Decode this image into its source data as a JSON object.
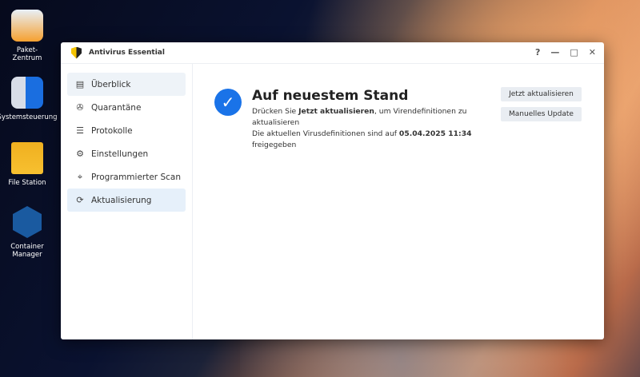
{
  "desktop": [
    {
      "label": "Paket-\nZentrum"
    },
    {
      "label": "Systemsteuerung"
    },
    {
      "label": "File Station"
    },
    {
      "label": "Container Manager"
    }
  ],
  "window": {
    "title": "Antivirus Essential",
    "controls": [
      "?",
      "—",
      "□",
      "✕"
    ]
  },
  "sidebar": {
    "items": [
      {
        "label": "Überblick",
        "icon": "▤"
      },
      {
        "label": "Quarantäne",
        "icon": "✇"
      },
      {
        "label": "Protokolle",
        "icon": "☰"
      },
      {
        "label": "Einstellungen",
        "icon": "⚙"
      },
      {
        "label": "Programmierter Scan",
        "icon": "⌖"
      },
      {
        "label": "Aktualisierung",
        "icon": "⟳"
      }
    ],
    "active": 5
  },
  "main": {
    "status_title": "Auf neuestem Stand",
    "line1_pre": "Drücken Sie ",
    "line1_bold": "Jetzt aktualisieren",
    "line1_post": ", um Virendefinitionen zu aktualisieren",
    "line2_pre": "Die aktuellen Virusdefinitionen sind auf ",
    "line2_bold": "05.04.2025 11:34",
    "line2_post": " freigegeben",
    "update_now_label": "Jetzt aktualisieren",
    "manual_update_label": "Manuelles Update"
  },
  "colors": {
    "accent": "#1a73e8",
    "active_bg": "#e6f0fa"
  }
}
